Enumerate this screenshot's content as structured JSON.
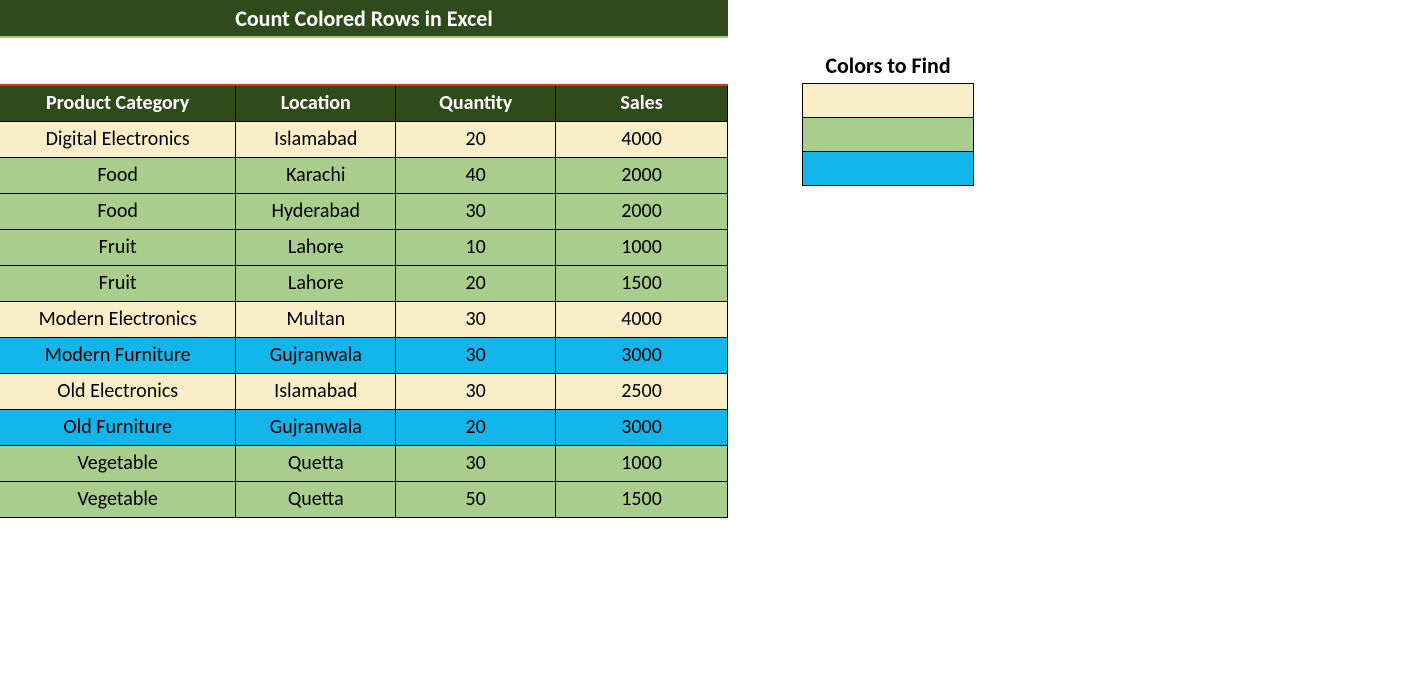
{
  "title": "Count Colored Rows in Excel",
  "headers": {
    "category": "Product Category",
    "location": "Location",
    "quantity": "Quantity",
    "sales": "Sales"
  },
  "rows": [
    {
      "category": "Digital Electronics",
      "location": "Islamabad",
      "quantity": "20",
      "sales": "4000",
      "color": "cream"
    },
    {
      "category": "Food",
      "location": "Karachi",
      "quantity": "40",
      "sales": "2000",
      "color": "green"
    },
    {
      "category": "Food",
      "location": "Hyderabad",
      "quantity": "30",
      "sales": "2000",
      "color": "green"
    },
    {
      "category": "Fruit",
      "location": "Lahore",
      "quantity": "10",
      "sales": "1000",
      "color": "green"
    },
    {
      "category": "Fruit",
      "location": "Lahore",
      "quantity": "20",
      "sales": "1500",
      "color": "green"
    },
    {
      "category": "Modern Electronics",
      "location": "Multan",
      "quantity": "30",
      "sales": "4000",
      "color": "cream"
    },
    {
      "category": "Modern Furniture",
      "location": "Gujranwala",
      "quantity": "30",
      "sales": "3000",
      "color": "blue"
    },
    {
      "category": "Old Electronics",
      "location": "Islamabad",
      "quantity": "30",
      "sales": "2500",
      "color": "cream"
    },
    {
      "category": "Old Furniture",
      "location": "Gujranwala",
      "quantity": "20",
      "sales": "3000",
      "color": "blue"
    },
    {
      "category": "Vegetable",
      "location": "Quetta",
      "quantity": "30",
      "sales": "1000",
      "color": "green"
    },
    {
      "category": "Vegetable",
      "location": "Quetta",
      "quantity": "50",
      "sales": "1500",
      "color": "green"
    }
  ],
  "legend": {
    "title": "Colors to Find",
    "colors": [
      "cream",
      "green",
      "blue"
    ]
  },
  "palette": {
    "cream": "#f9eec8",
    "green": "#a8cd8c",
    "blue": "#13b5ea",
    "header": "#2f4b1c"
  }
}
